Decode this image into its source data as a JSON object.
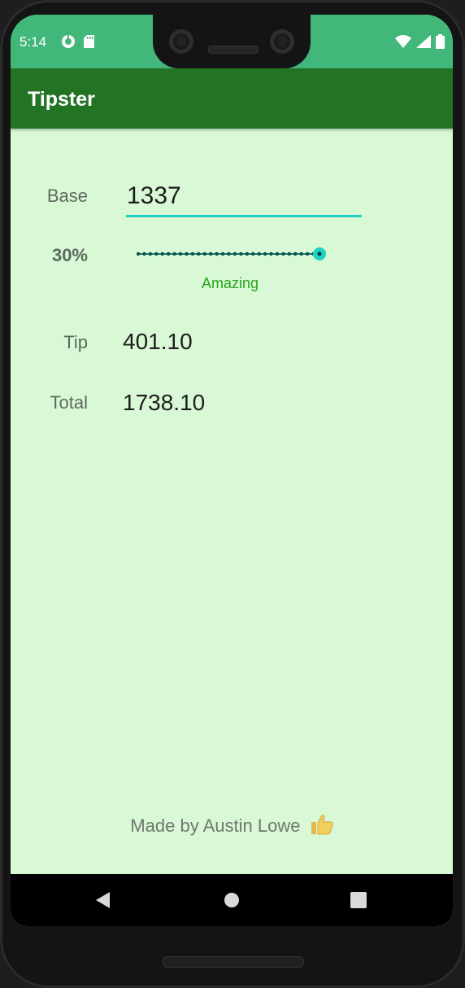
{
  "status_bar": {
    "time": "5:14",
    "left_icons": [
      "data-saver-icon",
      "sd-card-icon"
    ],
    "right_icons": [
      "wifi-icon",
      "cell-signal-icon",
      "battery-icon"
    ],
    "color": "#42b77a"
  },
  "app_bar": {
    "title": "Tipster",
    "color": "#237325"
  },
  "form": {
    "base_label": "Base",
    "base_value": "1337",
    "tip_percent_label": "30%",
    "tip_percent_value": 30,
    "slider_max": 30,
    "tip_description": "Amazing",
    "tip_label": "Tip",
    "tip_amount": "401.10",
    "total_label": "Total",
    "total_amount": "1738.10"
  },
  "footer": {
    "text": "Made by Austin Lowe",
    "icon": "thumbs-up-icon"
  },
  "nav_bar": {
    "buttons": [
      "back-icon",
      "home-icon",
      "recents-icon"
    ]
  },
  "colors": {
    "background": "#d8f8d6",
    "accent": "#1fd1c1",
    "description": "#22a51a"
  }
}
